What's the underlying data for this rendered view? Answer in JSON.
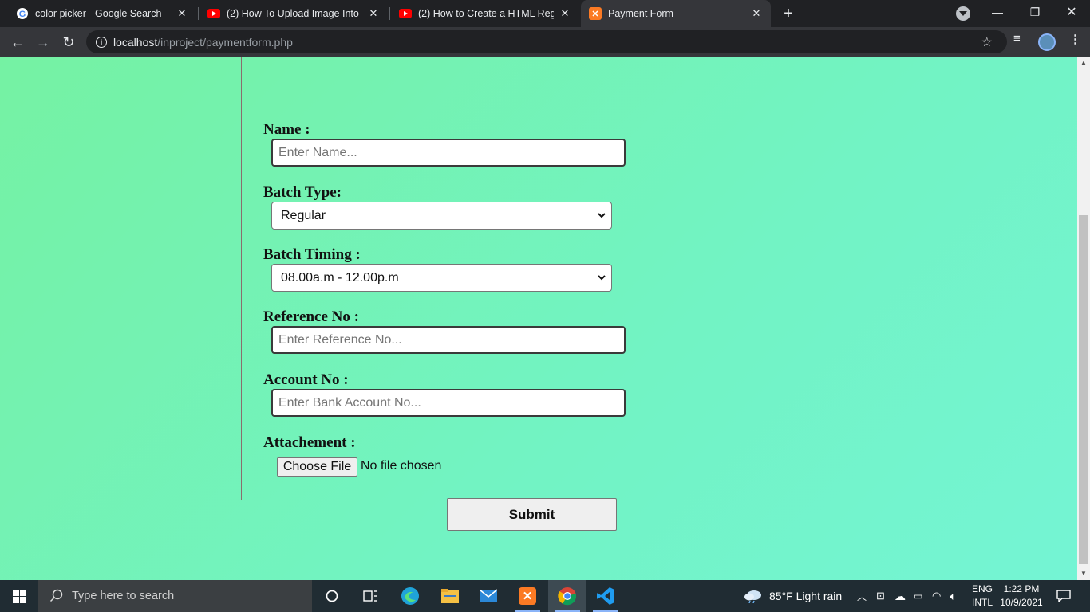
{
  "browser": {
    "tabs": [
      {
        "title": "color picker - Google Search",
        "icon": "google-icon"
      },
      {
        "title": "(2) How To Upload Image Into M",
        "icon": "youtube-icon"
      },
      {
        "title": "(2) How to Create a HTML Regist",
        "icon": "youtube-icon"
      },
      {
        "title": "Payment Form",
        "icon": "xampp-icon"
      }
    ],
    "url_host": "localhost",
    "url_path": "/inproject/paymentform.php"
  },
  "form": {
    "name_label": "Name :",
    "name_placeholder": "Enter Name...",
    "batch_type_label": "Batch Type:",
    "batch_type_value": "Regular",
    "batch_timing_label": "Batch Timing :",
    "batch_timing_value": "08.00a.m - 12.00p.m",
    "reference_label": "Reference No :",
    "reference_placeholder": "Enter Reference No...",
    "account_label": "Account No :",
    "account_placeholder": "Enter Bank Account No...",
    "attachment_label": "Attachement :",
    "choose_file_label": "Choose File",
    "no_file_text": "No file chosen",
    "submit_label": "Submit"
  },
  "taskbar": {
    "search_placeholder": "Type here to search",
    "weather": "85°F  Light rain",
    "lang_top": "ENG",
    "lang_bottom": "INTL",
    "time": "1:22 PM",
    "date": "10/9/2021"
  },
  "colors": {
    "page_bg_start": "#75f2a3",
    "page_bg_end": "#74f4d4",
    "chrome_dark": "#202124",
    "toolbar": "#35363a"
  }
}
